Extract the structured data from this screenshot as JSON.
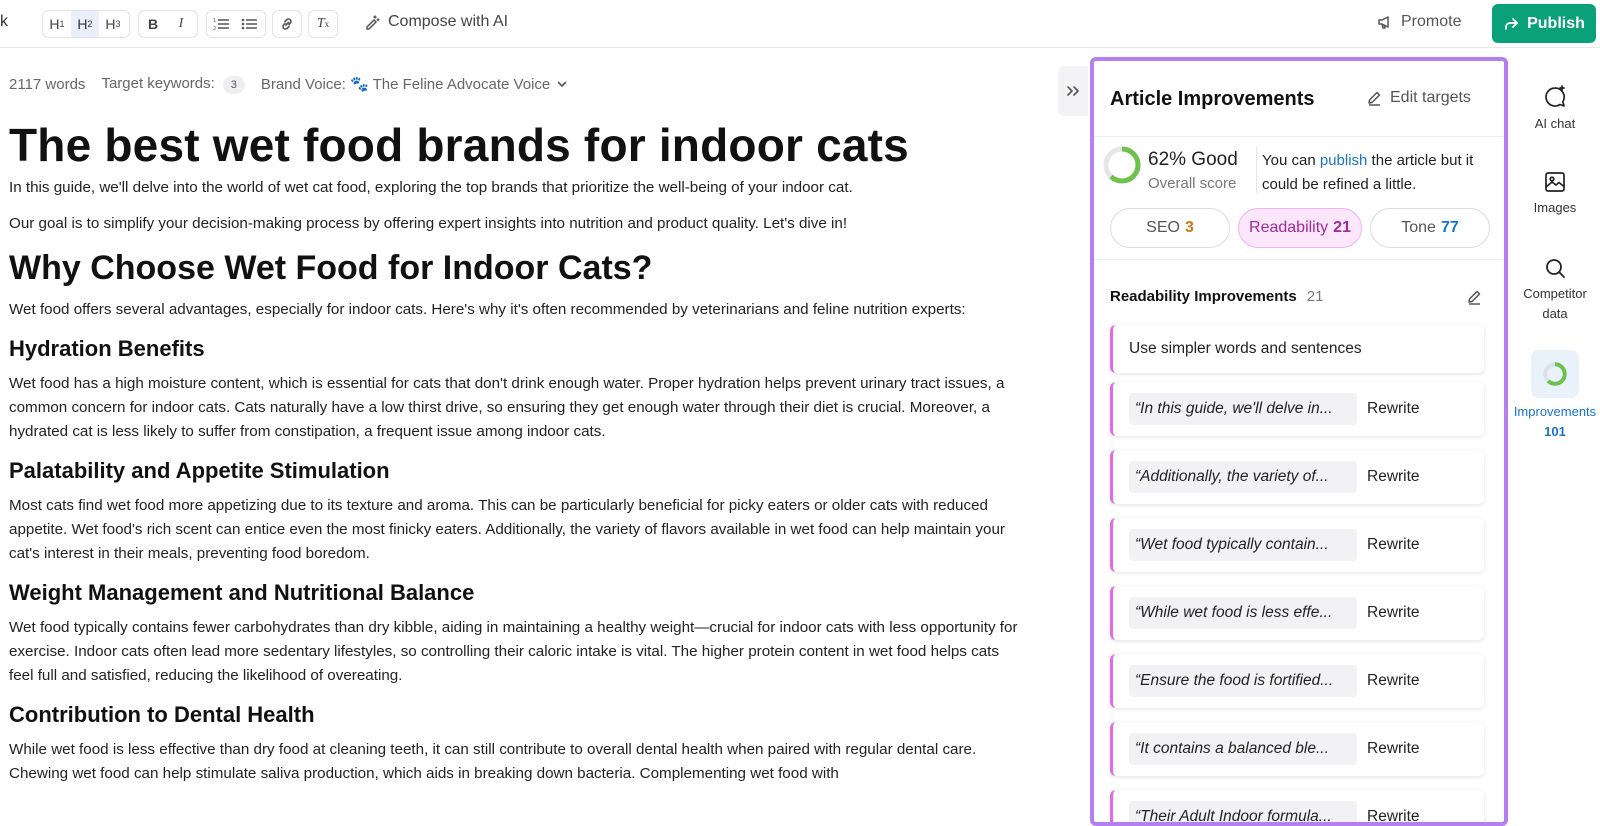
{
  "toolbar": {
    "back_label": "k",
    "heading_buttons": [
      "H1",
      "H2",
      "H3"
    ],
    "compose_label": "Compose with AI",
    "promote_label": "Promote",
    "publish_label": "Publish",
    "accent_color": "#0aa07a"
  },
  "meta": {
    "words": "2117 words",
    "keywords_label": "Target keywords:",
    "keywords_count": "3",
    "brand_voice": "Brand Voice: 🐾 The Feline Advocate Voice"
  },
  "article": {
    "title": "The best wet food brands for indoor cats",
    "intro1": "In this guide, we'll delve into the world of wet cat food, exploring the top brands that prioritize the well-being of your indoor cat.",
    "intro2": "Our goal is to simplify your decision-making process by offering expert insights into nutrition and product quality. Let's dive in!",
    "h2_why": "Why Choose Wet Food for Indoor Cats?",
    "p_why": "Wet food offers several advantages, especially for indoor cats. Here's why it's often recommended by veterinarians and feline nutrition experts:",
    "h3_hydration": "Hydration Benefits",
    "p_hydration": "Wet food has a high moisture content, which is essential for cats that don't drink enough water. Proper hydration helps prevent urinary tract issues, a common concern for indoor cats. Cats naturally have a low thirst drive, so ensuring they get enough water through their diet is crucial. Moreover, a hydrated cat is less likely to suffer from constipation, a frequent issue among indoor cats.",
    "h3_palatability": "Palatability and Appetite Stimulation",
    "p_palatability": "Most cats find wet food more appetizing due to its texture and aroma. This can be particularly beneficial for picky eaters or older cats with reduced appetite. Wet food's rich scent can entice even the most finicky eaters. Additionally, the variety of flavors available in wet food can help maintain your cat's interest in their meals, preventing food boredom.",
    "h3_weight": "Weight Management and Nutritional Balance",
    "p_weight": "Wet food typically contains fewer carbohydrates than dry kibble, aiding in maintaining a healthy weight—crucial for indoor cats with less opportunity for exercise. Indoor cats often lead more sedentary lifestyles, so controlling their caloric intake is vital. The higher protein content in wet food helps cats feel full and satisfied, reducing the likelihood of overeating.",
    "h3_dental": "Contribution to Dental Health",
    "p_dental": "While wet food is less effective than dry food at cleaning teeth, it can still contribute to overall dental health when paired with regular dental care. Chewing wet food can help stimulate saliva production, which aids in breaking down bacteria. Complementing wet food with"
  },
  "panel": {
    "title": "Article Improvements",
    "edit_targets": "Edit targets",
    "score_value": "62% Good",
    "score_fraction": 0.62,
    "score_label": "Overall score",
    "msg_pre": "You can ",
    "msg_link": "publish",
    "msg_post": " the article but it could be refined a little.",
    "chips": {
      "seo_label": "SEO",
      "seo_count": "3",
      "read_label": "Readability",
      "read_count": "21",
      "tone_label": "Tone",
      "tone_count": "77"
    },
    "section_title": "Readability Improvements",
    "section_count": "21",
    "simple_card": "Use simpler words and sentences",
    "rewrite_label": "Rewrite",
    "quotes": [
      "“In this guide, we'll delve in...",
      "“Additionally, the variety of...",
      "“Wet food typically contain...",
      "“While wet food is less effe...",
      "“Ensure the food is fortified...",
      "“It contains a balanced ble...",
      "“Their Adult Indoor formula..."
    ]
  },
  "rail": {
    "ai_chat": "AI chat",
    "images": "Images",
    "competitor": "Competitor data",
    "improvements": "Improvements",
    "improvements_count": "101"
  }
}
